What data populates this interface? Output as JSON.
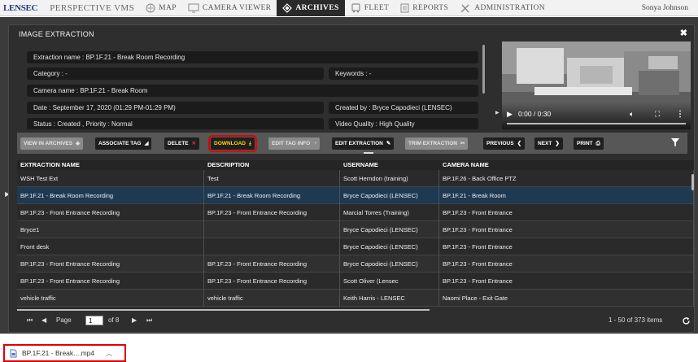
{
  "nav": {
    "logo": "LENSEC",
    "app": "PERSPECTIVE VMS",
    "items": [
      "MAP",
      "CAMERA VIEWER",
      "ARCHIVES",
      "FLEET",
      "REPORTS",
      "ADMINISTRATION"
    ],
    "active": "ARCHIVES",
    "user": "Sonya Johnson"
  },
  "modal": {
    "title": "IMAGE EXTRACTION",
    "close": "✖"
  },
  "details": {
    "extraction_name": "Extraction name  : BP.1F.21 - Break Room Recording",
    "category": "Category  : -",
    "keywords": "Keywords  : -",
    "camera_name": "Camera name  : BP.1F.21 - Break Room",
    "date": "Date  : September 17, 2020 (01:29 PM-01:29 PM)",
    "created_by": "Created by  : Bryce Capodieci (LENSEC)",
    "status": "Status  : Created ,  Priority  : Normal",
    "video_quality": "Video Quality  : High Quality"
  },
  "video": {
    "time": "0:00 / 0:30"
  },
  "toolbar": {
    "view_in_archives": "VIEW IN ARCHIVES",
    "associate_tag": "ASSOCIATE TAG",
    "delete": "DELETE",
    "download": "DOWNLOAD",
    "edit_tag_info": "EDIT TAG INFO",
    "edit_extraction": "EDIT EXTRACTION",
    "trim_extraction": "TRIM EXTRACTION",
    "previous": "PREVIOUS",
    "next": "NEXT",
    "print": "PRINT"
  },
  "grid": {
    "columns": [
      "EXTRACTION NAME",
      "DESCRIPTION",
      "USERNAME",
      "CAMERA NAME"
    ],
    "selected_row": 1,
    "rows": [
      [
        "WSH Test Ext",
        "Test",
        "Scott Herndon (training)",
        "BP.1F.26 - Back Office PTZ"
      ],
      [
        "BP.1F.21 - Break Room Recording",
        "BP.1F.21 - Break Room Recording",
        "Bryce Capodieci (LENSEC)",
        "BP.1F.21 - Break Room"
      ],
      [
        "BP.1F.23 - Front Entrance Recording",
        "BP.1F.23 - Front Entrance Recording",
        "Marcial Torres (Training)",
        "BP.1F.23 - Front Entrance"
      ],
      [
        "Bryce1",
        "",
        "Bryce Capodieci (LENSEC)",
        "BP.1F.23 - Front Entrance"
      ],
      [
        "Front desk",
        "",
        "Bryce Capodieci (LENSEC)",
        "BP.1F.23 - Front Entrance"
      ],
      [
        "BP.1F.23 - Front Entrance Recording",
        "BP.1F.23 - Front Entrance Recording",
        "Bryce Capodieci (LENSEC)",
        "BP.1F.23 - Front Entrance"
      ],
      [
        "BP.1F.23 - Front Entrance Recording",
        "BP.1F.23 - Front Entrance Recording",
        "Scott Oliver (Lensec",
        "BP.1F.23 - Front Entrance"
      ],
      [
        "vehicle traffic",
        "vehicle traffic",
        "Keith Harris - LENSEC",
        "Naomi Place - Exit Gate"
      ]
    ]
  },
  "pager": {
    "page_label": "Page",
    "page": "1",
    "of": "of 8",
    "summary": "1 - 50 of 373 items"
  },
  "download_bar": {
    "file": "BP.1F.21 - Break....mp4"
  },
  "colors": {
    "selected_row": "#1d3a52",
    "download_highlight": "#e00000",
    "download_text": "#ffd700"
  }
}
